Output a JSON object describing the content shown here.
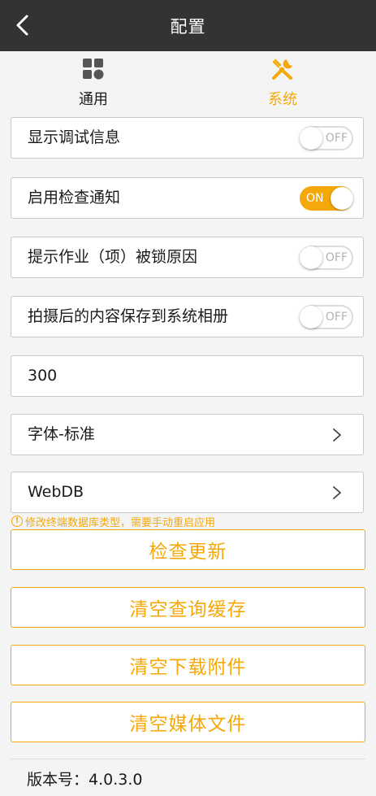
{
  "header": {
    "title": "配置",
    "back_icon": "chevron-left-icon"
  },
  "tabs": [
    {
      "label": "通用",
      "icon": "grid-icon",
      "active": false
    },
    {
      "label": "系统",
      "icon": "tools-icon",
      "active": true
    }
  ],
  "settings": {
    "debug_info": {
      "label": "显示调试信息",
      "state": "OFF"
    },
    "check_notify": {
      "label": "启用检查通知",
      "state": "ON"
    },
    "lock_reason": {
      "label": "提示作业（项）被锁原因",
      "state": "OFF"
    },
    "save_album": {
      "label": "拍摄后的内容保存到系统相册",
      "state": "OFF"
    },
    "number_value": "300",
    "font_option": {
      "label": "字体-标准"
    },
    "db_option": {
      "label": "WebDB"
    }
  },
  "warning": {
    "icon": "warning-circle-icon",
    "text": "修改终端数据库类型，需要手动重启应用"
  },
  "actions": {
    "check_update": "检查更新",
    "clear_query_cache": "清空查询缓存",
    "clear_downloads": "清空下载附件",
    "clear_media": "清空媒体文件"
  },
  "footer": {
    "version": "版本号：4.0.3.0"
  },
  "colors": {
    "accent": "#f5a80a",
    "header_bg": "#333333",
    "page_bg": "#f4f4f4"
  }
}
